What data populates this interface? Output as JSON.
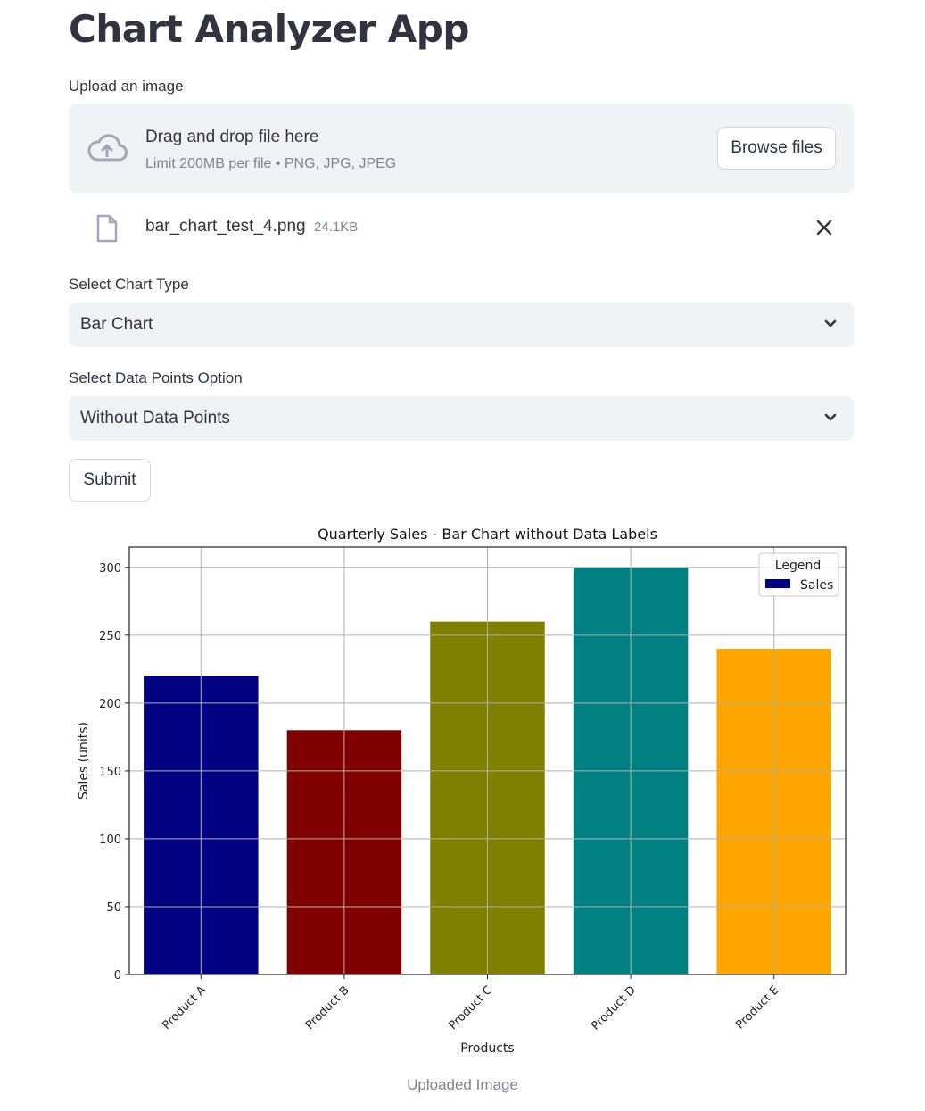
{
  "app": {
    "title": "Chart Analyzer App"
  },
  "uploader": {
    "label": "Upload an image",
    "drop_title": "Drag and drop file here",
    "limit_text": "Limit 200MB per file • PNG, JPG, JPEG",
    "browse_label": "Browse files",
    "file": {
      "name": "bar_chart_test_4.png",
      "size": "24.1KB"
    }
  },
  "chart_type": {
    "label": "Select Chart Type",
    "value": "Bar Chart"
  },
  "data_points": {
    "label": "Select Data Points Option",
    "value": "Without Data Points"
  },
  "submit_label": "Submit",
  "caption": "Uploaded Image",
  "icons": {
    "upload": "cloud-upload-icon",
    "file": "file-icon",
    "remove": "close-icon",
    "dropdown": "chevron-down-icon"
  },
  "chart_data": {
    "type": "bar",
    "title": "Quarterly Sales - Bar Chart without Data Labels",
    "xlabel": "Products",
    "ylabel": "Sales (units)",
    "categories": [
      "Product A",
      "Product B",
      "Product C",
      "Product D",
      "Product E"
    ],
    "values": [
      220,
      180,
      260,
      300,
      240
    ],
    "colors": [
      "#000080",
      "#800000",
      "#808000",
      "#008080",
      "#ffa500"
    ],
    "ylim": [
      0,
      315
    ],
    "yticks": [
      0,
      50,
      100,
      150,
      200,
      250,
      300
    ],
    "grid": true,
    "legend": {
      "title": "Legend",
      "entries": [
        "Sales"
      ],
      "placement": "top-right"
    }
  }
}
